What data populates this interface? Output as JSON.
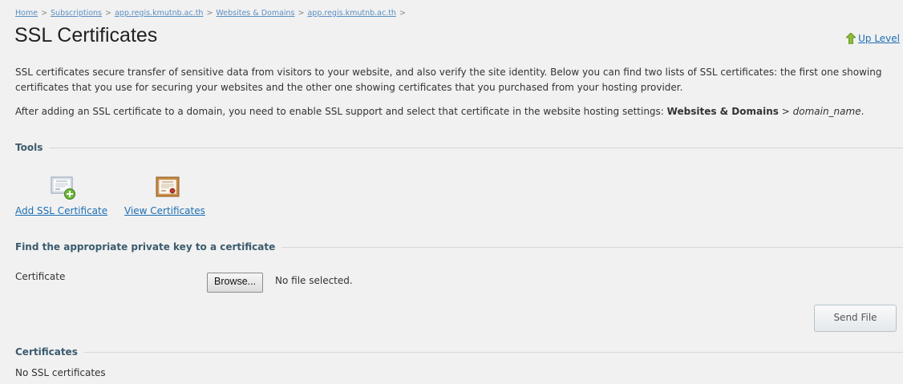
{
  "breadcrumb": {
    "items": [
      "Home",
      "Subscriptions",
      "app.regis.kmutnb.ac.th",
      "Websites & Domains",
      "app.regis.kmutnb.ac.th"
    ],
    "separator": ">"
  },
  "header": {
    "title": "SSL Certificates",
    "up_level": "Up Level"
  },
  "intro": {
    "p1": "SSL certificates secure transfer of sensitive data from visitors to your website, and also verify the site identity. Below you can find two lists of SSL certificates: the first one showing certificates that you use for securing your websites and the other one showing certificates that you purchased from your hosting provider.",
    "p2_start": "After adding an SSL certificate to a domain, you need to enable SSL support and select that certificate in the website hosting settings: ",
    "p2_bold": "Websites & Domains",
    "p2_sep": " > ",
    "p2_italic": "domain_name",
    "p2_end": "."
  },
  "tools": {
    "title": "Tools",
    "add_label": "Add SSL Certificate",
    "view_label": "View Certificates"
  },
  "find_key": {
    "title": "Find the appropriate private key to a certificate",
    "certificate_label": "Certificate",
    "browse_label": "Browse...",
    "file_status": "No file selected.",
    "send_label": "Send File"
  },
  "certificates": {
    "title": "Certificates",
    "empty": "No SSL certificates"
  },
  "colors": {
    "link": "#1c6fb4",
    "section_title": "#3b5b6e",
    "background": "#f1f1f1"
  }
}
